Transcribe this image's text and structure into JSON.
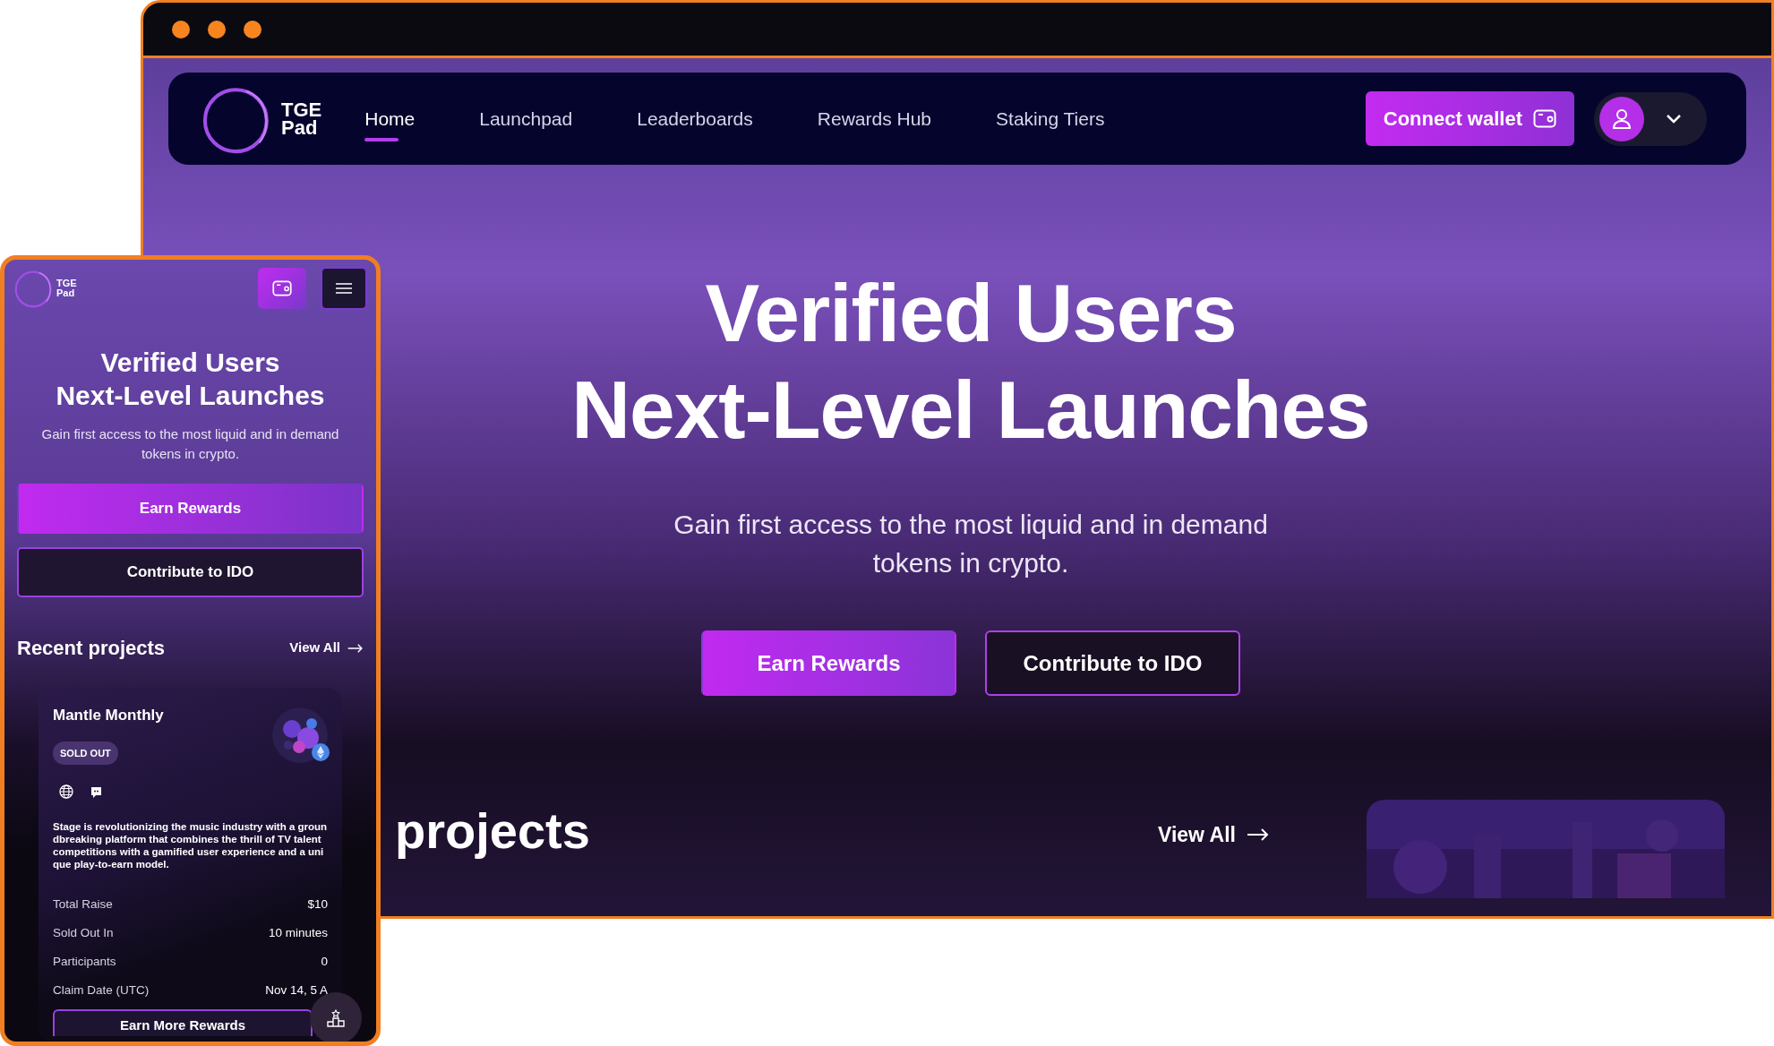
{
  "desktop": {
    "nav": {
      "logo": [
        "TGE",
        "Pad"
      ],
      "items": [
        {
          "label": "Home",
          "selected": true
        },
        {
          "label": "Launchpad",
          "selected": false
        },
        {
          "label": "Leaderboards",
          "selected": false
        },
        {
          "label": "Rewards Hub",
          "selected": false
        },
        {
          "label": "Staking Tiers",
          "selected": false
        }
      ],
      "connect_button": "Connect wallet"
    },
    "hero": {
      "title_lines": [
        "Verified Users",
        "Next-Level Launches"
      ],
      "subtitle": "Gain first access to the most liquid and in demand tokens in crypto.",
      "buttons": [
        {
          "label": "Earn Rewards",
          "kind": "primary"
        },
        {
          "label": "Contribute to IDO",
          "kind": "outline"
        }
      ]
    },
    "projects": {
      "title": "projects",
      "view_all": "View All"
    }
  },
  "mobile": {
    "header": {
      "logo": [
        "TGE",
        "Pad"
      ]
    },
    "hero": {
      "title_lines": [
        "Verified Users",
        "Next-Level Launches"
      ],
      "subtitle": "Gain first access to the most liquid and in demand tokens in crypto.",
      "buttons": [
        {
          "label": "Earn Rewards",
          "kind": "primary"
        },
        {
          "label": "Contribute to IDO",
          "kind": "outline"
        }
      ]
    },
    "projects": {
      "title": "Recent projects",
      "view_all": "View All"
    },
    "card": {
      "name": "Mantle Monthly",
      "status": "SOLD OUT",
      "description": "Stage is revolutionizing the music industry with a groundbreaking platform that combines the thrill of TV talent competitions with a gamified user experience and a unique play-to-earn model.",
      "stats": [
        {
          "label": "Total Raise",
          "value": "$10"
        },
        {
          "label": "Sold Out In",
          "value": "10 minutes"
        },
        {
          "label": "Participants",
          "value": "0"
        },
        {
          "label": "Claim Date (UTC)",
          "value": "Nov 14, 5 A"
        }
      ],
      "button": "Earn More Rewards"
    }
  }
}
